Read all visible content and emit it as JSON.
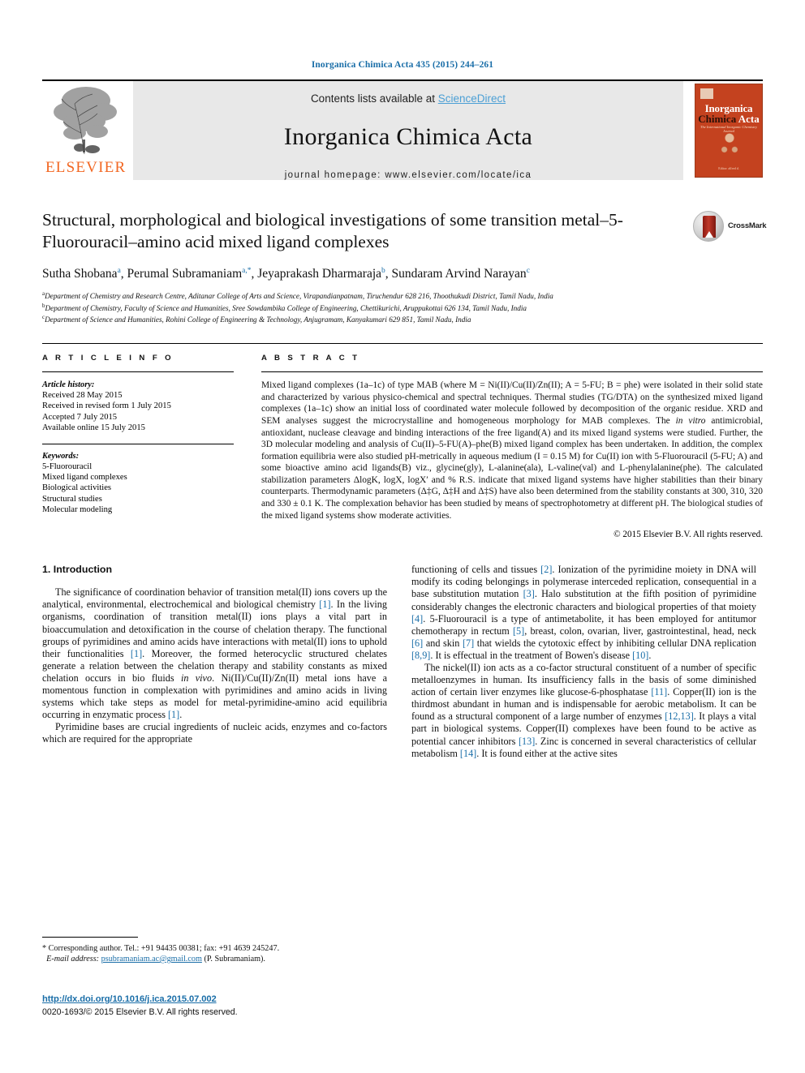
{
  "running_head": "Inorganica Chimica Acta 435 (2015) 244–261",
  "masthead": {
    "publisher": "ELSEVIER",
    "contents_prefix": "Contents lists available at ",
    "contents_link": "ScienceDirect",
    "journal_title": "Inorganica Chimica Acta",
    "homepage": "journal homepage: www.elsevier.com/locate/ica",
    "cover": {
      "line1": "Inorganica",
      "line2a": "Chimica",
      "line2b": "Acta",
      "subtitle": "The International Inorganic Chemistry Journal",
      "footer": "Editor: alfred d."
    }
  },
  "article": {
    "title": "Structural, morphological and biological investigations of some transition metal–5-Fluorouracil–amino acid mixed ligand complexes",
    "crossmark_label": "CrossMark",
    "authors": [
      {
        "name": "Sutha Shobana",
        "sup": "a"
      },
      {
        "name": "Perumal Subramaniam",
        "sup": "a,*"
      },
      {
        "name": "Jeyaprakash Dharmaraja",
        "sup": "b"
      },
      {
        "name": "Sundaram Arvind Narayan",
        "sup": "c"
      }
    ],
    "affiliations": [
      {
        "sup": "a",
        "text": "Department of Chemistry and Research Centre, Aditanar College of Arts and Science, Virapandianpatnam, Tiruchendur 628 216, Thoothukudi District, Tamil Nadu, India"
      },
      {
        "sup": "b",
        "text": "Department of Chemistry, Faculty of Science and Humanities, Sree Sowdambika College of Engineering, Chettikurichi, Aruppukottai 626 134, Tamil Nadu, India"
      },
      {
        "sup": "c",
        "text": "Department of Science and Humanities, Rohini College of Engineering & Technology, Anjugramam, Kanyakumari 629 851, Tamil Nadu, India"
      }
    ]
  },
  "article_info": {
    "heading": "A R T I C L E   I N F O",
    "history_label": "Article history:",
    "history": [
      "Received 28 May 2015",
      "Received in revised form 1 July 2015",
      "Accepted 7 July 2015",
      "Available online 15 July 2015"
    ],
    "keywords_label": "Keywords:",
    "keywords": [
      "5-Fluorouracil",
      "Mixed ligand complexes",
      "Biological activities",
      "Structural studies",
      "Molecular modeling"
    ]
  },
  "abstract": {
    "heading": "A B S T R A C T",
    "text": "Mixed ligand complexes (1a–1c) of type MAB (where M = Ni(II)/Cu(II)/Zn(II); A = 5-FU; B = phe) were isolated in their solid state and characterized by various physico-chemical and spectral techniques. Thermal studies (TG/DTA) on the synthesized mixed ligand complexes (1a–1c) show an initial loss of coordinated water molecule followed by decomposition of the organic residue. XRD and SEM analyses suggest the microcrystalline and homogeneous morphology for MAB complexes. The in vitro antimicrobial, antioxidant, nuclease cleavage and binding interactions of the free ligand(A) and its mixed ligand systems were studied. Further, the 3D molecular modeling and analysis of Cu(II)–5-FU(A)–phe(B) mixed ligand complex has been undertaken. In addition, the complex formation equilibria were also studied pH-metrically in aqueous medium (I = 0.15 M) for Cu(II) ion with 5-Fluorouracil (5-FU; A) and some bioactive amino acid ligands(B) viz., glycine(gly), L-alanine(ala), L-valine(val) and L-phenylalanine(phe). The calculated stabilization parameters ΔlogK, logX, logX′ and % R.S. indicate that mixed ligand systems have higher stabilities than their binary counterparts. Thermodynamic parameters (Δ‡G, Δ‡H and Δ‡S) have also been determined from the stability constants at 300, 310, 320 and 330 ± 0.1 K. The complexation behavior has been studied by means of spectrophotometry at different pH. The biological studies of the mixed ligand systems show moderate activities.",
    "copyright": "© 2015 Elsevier B.V. All rights reserved."
  },
  "body": {
    "section_title": "1. Introduction",
    "left_paragraphs": [
      "The significance of coordination behavior of transition metal(II) ions covers up the analytical, environmental, electrochemical and biological chemistry [1]. In the living organisms, coordination of transition metal(II) ions plays a vital part in bioaccumulation and detoxification in the course of chelation therapy. The functional groups of pyrimidines and amino acids have interactions with metal(II) ions to uphold their functionalities [1]. Moreover, the formed heterocyclic structured chelates generate a relation between the chelation therapy and stability constants as mixed chelation occurs in bio fluids in vivo. Ni(II)/Cu(II)/Zn(II) metal ions have a momentous function in complexation with pyrimidines and amino acids in living systems which take steps as model for metal-pyrimidine-amino acid equilibria occurring in enzymatic process [1].",
      "Pyrimidine bases are crucial ingredients of nucleic acids, enzymes and co-factors which are required for the appropriate"
    ],
    "right_paragraphs": [
      "functioning of cells and tissues [2]. Ionization of the pyrimidine moiety in DNA will modify its coding belongings in polymerase interceded replication, consequential in a base substitution mutation [3]. Halo substitution at the fifth position of pyrimidine considerably changes the electronic characters and biological properties of that moiety [4]. 5-Fluorouracil is a type of antimetabolite, it has been employed for antitumor chemotherapy in rectum [5], breast, colon, ovarian, liver, gastrointestinal, head, neck [6] and skin [7] that wields the cytotoxic effect by inhibiting cellular DNA replication [8,9]. It is effectual in the treatment of Bowen's disease [10].",
      "The nickel(II) ion acts as a co-factor structural constituent of a number of specific metalloenzymes in human. Its insufficiency falls in the basis of some diminished action of certain liver enzymes like glucose-6-phosphatase [11]. Copper(II) ion is the thirdmost abundant in human and is indispensable for aerobic metabolism. It can be found as a structural component of a large number of enzymes [12,13]. It plays a vital part in biological systems. Copper(II) complexes have been found to be active as potential cancer inhibitors [13]. Zinc is concerned in several characteristics of cellular metabolism [14]. It is found either at the active sites"
    ]
  },
  "footer": {
    "corresponding": "* Corresponding author. Tel.: +91 94435 00381; fax: +91 4639 245247.",
    "email_label": "E-mail address:",
    "email": "psubramaniam.ac@gmail.com",
    "email_suffix": "(P. Subramaniam).",
    "doi": "http://dx.doi.org/10.1016/j.ica.2015.07.002",
    "issn": "0020-1693/© 2015 Elsevier B.V. All rights reserved."
  },
  "colors": {
    "link": "#1a6ea8",
    "science_direct": "#4b9fd5",
    "elsevier_orange": "#f26722",
    "cover_red": "#c4421f"
  }
}
